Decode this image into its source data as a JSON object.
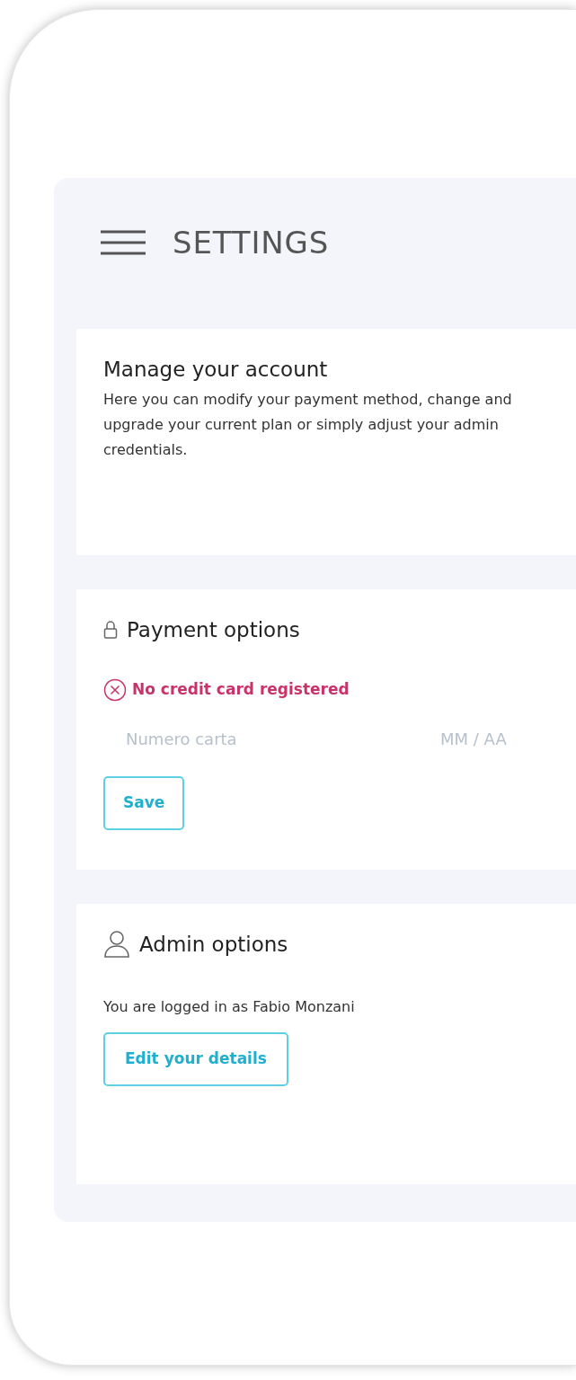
{
  "header": {
    "title": "SETTINGS"
  },
  "account": {
    "title": "Manage your account",
    "description": "Here you can modify your payment method, change and upgrade your current plan or simply adjust your admin credentials."
  },
  "payment": {
    "title": "Payment options",
    "error": "No credit card registered",
    "card_number": {
      "placeholder": "Numero carta"
    },
    "expiry": {
      "placeholder": "MM / AA"
    },
    "save_button": "Save"
  },
  "admin": {
    "title": "Admin options",
    "status": "You are logged in as Fabio Monzani",
    "edit_button": "Edit your details"
  }
}
